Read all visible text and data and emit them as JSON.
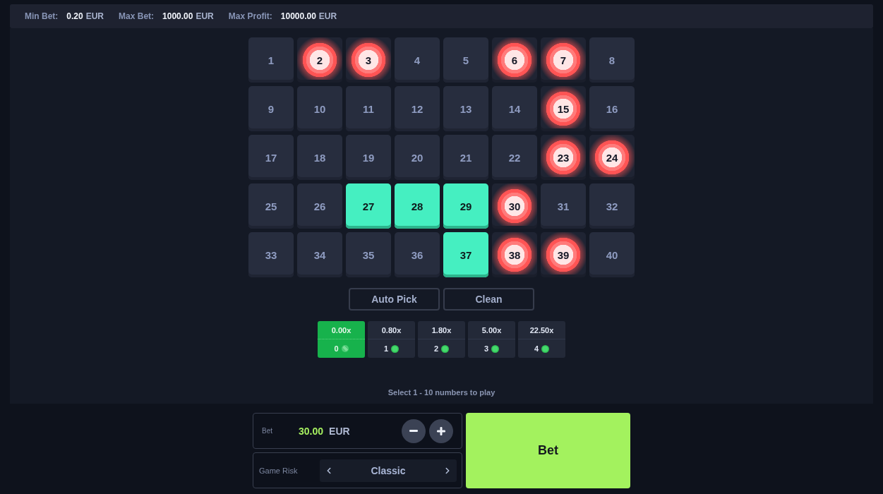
{
  "limits": [
    {
      "label": "Min Bet:",
      "amount": "0.20",
      "currency": "EUR"
    },
    {
      "label": "Max Bet:",
      "amount": "1000.00",
      "currency": "EUR"
    },
    {
      "label": "Max Profit:",
      "amount": "10000.00",
      "currency": "EUR"
    }
  ],
  "board": {
    "tiles": [
      {
        "number": "1",
        "selected": false,
        "drawn": false
      },
      {
        "number": "2",
        "selected": false,
        "drawn": true
      },
      {
        "number": "3",
        "selected": false,
        "drawn": true
      },
      {
        "number": "4",
        "selected": false,
        "drawn": false
      },
      {
        "number": "5",
        "selected": false,
        "drawn": false
      },
      {
        "number": "6",
        "selected": false,
        "drawn": true
      },
      {
        "number": "7",
        "selected": false,
        "drawn": true
      },
      {
        "number": "8",
        "selected": false,
        "drawn": false
      },
      {
        "number": "9",
        "selected": false,
        "drawn": false
      },
      {
        "number": "10",
        "selected": false,
        "drawn": false
      },
      {
        "number": "11",
        "selected": false,
        "drawn": false
      },
      {
        "number": "12",
        "selected": false,
        "drawn": false
      },
      {
        "number": "13",
        "selected": false,
        "drawn": false
      },
      {
        "number": "14",
        "selected": false,
        "drawn": false
      },
      {
        "number": "15",
        "selected": false,
        "drawn": true
      },
      {
        "number": "16",
        "selected": false,
        "drawn": false
      },
      {
        "number": "17",
        "selected": false,
        "drawn": false
      },
      {
        "number": "18",
        "selected": false,
        "drawn": false
      },
      {
        "number": "19",
        "selected": false,
        "drawn": false
      },
      {
        "number": "20",
        "selected": false,
        "drawn": false
      },
      {
        "number": "21",
        "selected": false,
        "drawn": false
      },
      {
        "number": "22",
        "selected": false,
        "drawn": false
      },
      {
        "number": "23",
        "selected": false,
        "drawn": true
      },
      {
        "number": "24",
        "selected": false,
        "drawn": true
      },
      {
        "number": "25",
        "selected": false,
        "drawn": false
      },
      {
        "number": "26",
        "selected": false,
        "drawn": false
      },
      {
        "number": "27",
        "selected": true,
        "drawn": false
      },
      {
        "number": "28",
        "selected": true,
        "drawn": false
      },
      {
        "number": "29",
        "selected": true,
        "drawn": false
      },
      {
        "number": "30",
        "selected": false,
        "drawn": true
      },
      {
        "number": "31",
        "selected": false,
        "drawn": false
      },
      {
        "number": "32",
        "selected": false,
        "drawn": false
      },
      {
        "number": "33",
        "selected": false,
        "drawn": false
      },
      {
        "number": "34",
        "selected": false,
        "drawn": false
      },
      {
        "number": "35",
        "selected": false,
        "drawn": false
      },
      {
        "number": "36",
        "selected": false,
        "drawn": false
      },
      {
        "number": "37",
        "selected": true,
        "drawn": false
      },
      {
        "number": "38",
        "selected": false,
        "drawn": true
      },
      {
        "number": "39",
        "selected": false,
        "drawn": true
      },
      {
        "number": "40",
        "selected": false,
        "drawn": false
      }
    ]
  },
  "actions": [
    "Auto Pick",
    "Clean"
  ],
  "payouts": [
    {
      "multiplier": "0.00x",
      "hits": "0",
      "selected": true
    },
    {
      "multiplier": "0.80x",
      "hits": "1",
      "selected": false
    },
    {
      "multiplier": "1.80x",
      "hits": "2",
      "selected": false
    },
    {
      "multiplier": "5.00x",
      "hits": "3",
      "selected": false
    },
    {
      "multiplier": "22.50x",
      "hits": "4",
      "selected": false
    }
  ],
  "hint": "Select 1 - 10 numbers to play",
  "bet": {
    "label": "Bet",
    "amount": "30.00",
    "currency": "EUR"
  },
  "risk": {
    "label": "Game Risk",
    "value": "Classic"
  },
  "bet_button": "Bet"
}
